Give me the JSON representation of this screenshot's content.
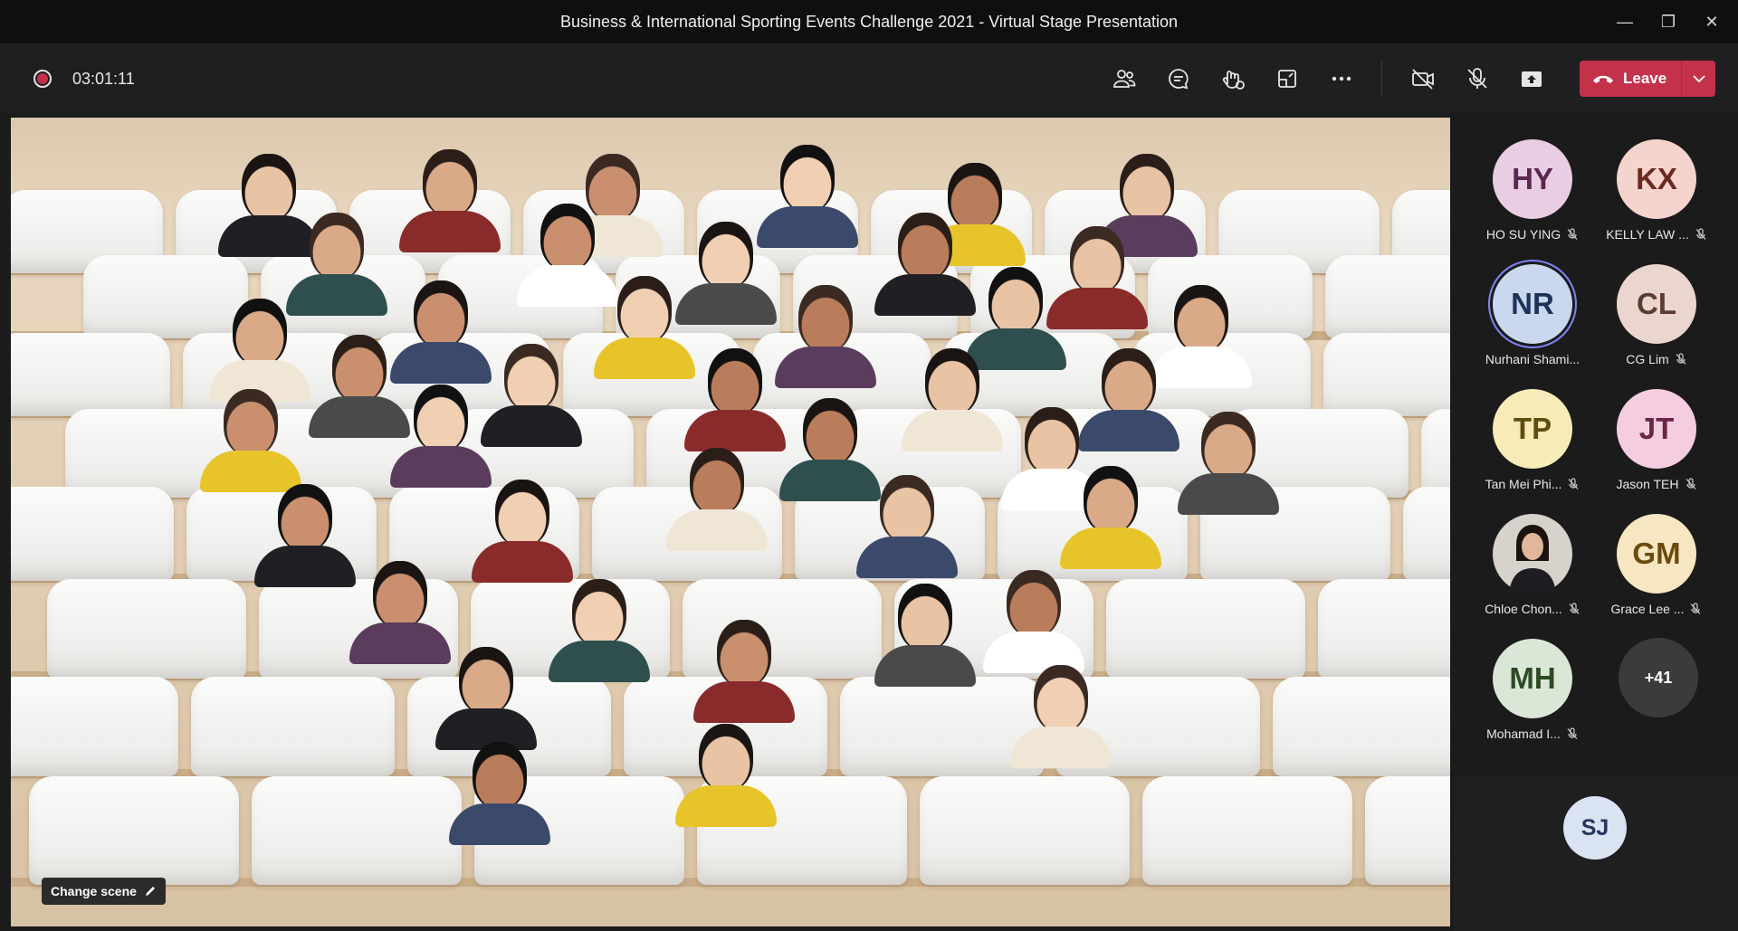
{
  "window": {
    "title": "Business & International Sporting Events Challenge 2021 - Virtual Stage Presentation",
    "minimize_glyph": "—",
    "maximize_glyph": "❐",
    "close_glyph": "✕"
  },
  "toolbar": {
    "timer": "03:01:11",
    "recording_icon": "recording-icon",
    "buttons": [
      "people-icon",
      "chat-icon",
      "reactions-icon",
      "rooms-icon",
      "more-icon",
      "camera-off-icon",
      "mic-off-icon",
      "share-icon"
    ],
    "leave_label": "Leave",
    "leave_color": "#c4314b"
  },
  "stage": {
    "change_scene_label": "Change scene"
  },
  "participants": [
    {
      "initials": "HY",
      "name": "HO SU YING",
      "bg": "#e8cde3",
      "fg": "#5b2650",
      "muted": true
    },
    {
      "initials": "KX",
      "name": "KELLY LAW ...",
      "bg": "#f5d4cd",
      "fg": "#6b2a20",
      "muted": true
    },
    {
      "initials": "NR",
      "name": "Nurhani Shami...",
      "bg": "#c9d8ee",
      "fg": "#1e3358",
      "muted": false,
      "speaking": true
    },
    {
      "initials": "CL",
      "name": "CG Lim",
      "bg": "#ead6cf",
      "fg": "#5c3b30",
      "muted": true
    },
    {
      "initials": "TP",
      "name": "Tan Mei Phi...",
      "bg": "#f7ebb8",
      "fg": "#5e4f10",
      "muted": true
    },
    {
      "initials": "JT",
      "name": "Jason TEH",
      "bg": "#f5cde0",
      "fg": "#6a2446",
      "muted": true
    },
    {
      "initials": "",
      "name": "Chloe Chon...",
      "bg": "#2b2b2b",
      "fg": "#ffffff",
      "muted": true,
      "photo": true
    },
    {
      "initials": "GM",
      "name": "Grace Lee ...",
      "bg": "#f6e7c2",
      "fg": "#6a4b0c",
      "muted": true
    },
    {
      "initials": "MH",
      "name": "Mohamad I...",
      "bg": "#dbe7d6",
      "fg": "#2d4a26",
      "muted": true
    }
  ],
  "more_participants": "+41",
  "self_view": {
    "initials": "SJ"
  }
}
